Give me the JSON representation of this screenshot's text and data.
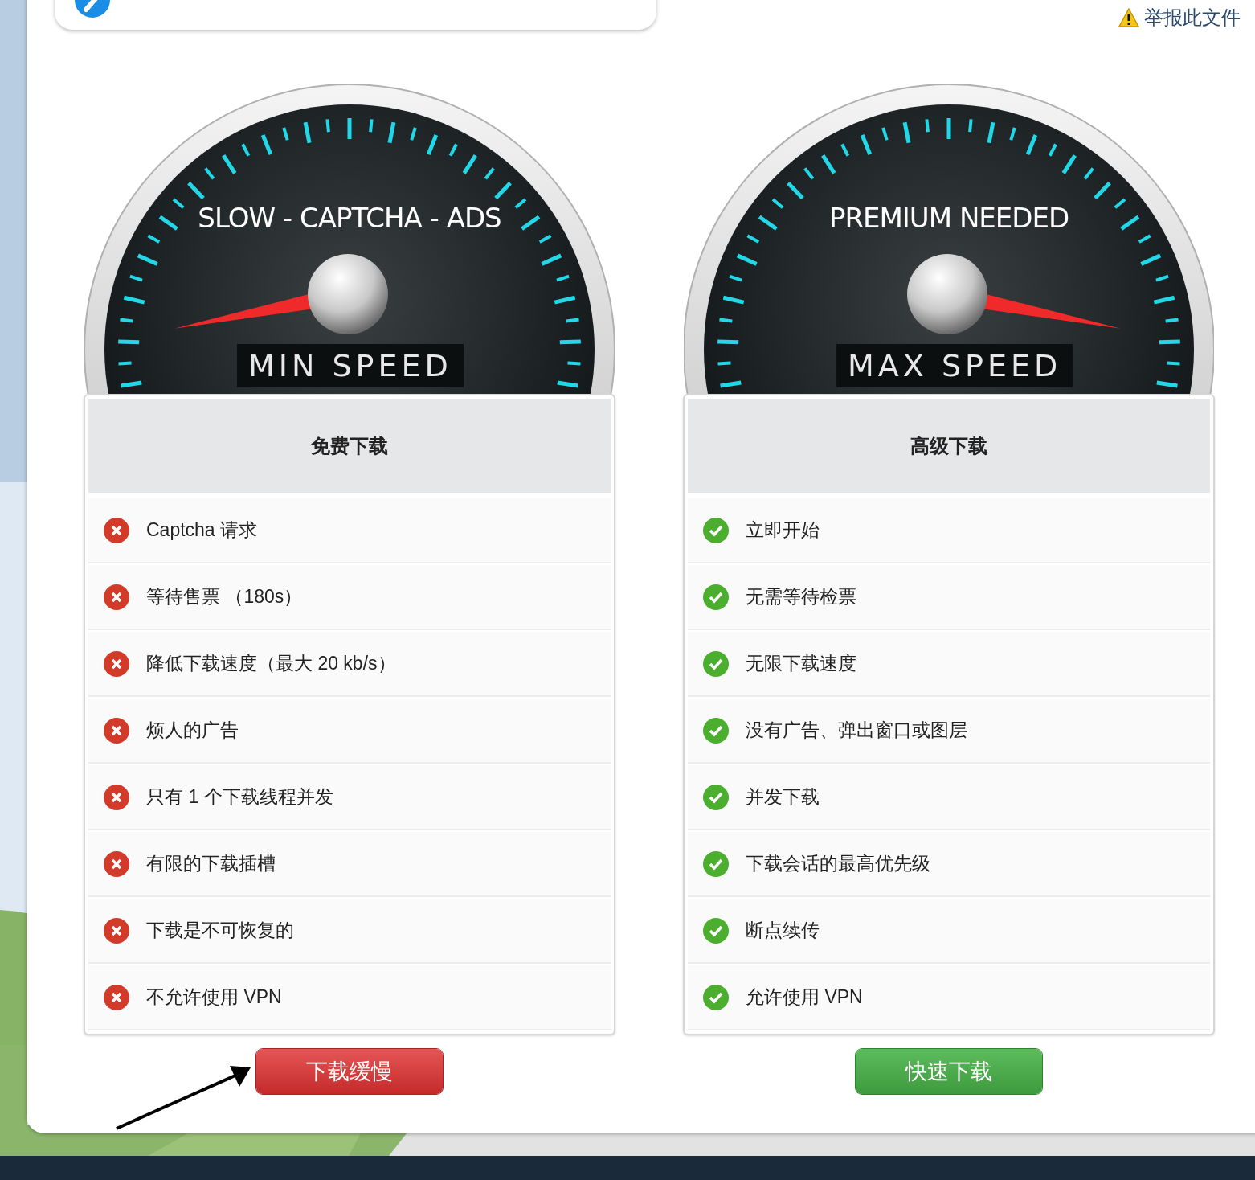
{
  "report_link": "举报此文件",
  "plans": [
    {
      "kind": "free",
      "gauge": {
        "caption": "SLOW - CAPTCHA - ADS",
        "label": "MIN SPEED"
      },
      "title": "免费下载",
      "features": [
        {
          "kind": "con",
          "text": "Captcha 请求"
        },
        {
          "kind": "con",
          "text": "等待售票 （180s）"
        },
        {
          "kind": "con",
          "text": "降低下载速度（最大 20 kb/s）"
        },
        {
          "kind": "con",
          "text": "烦人的广告"
        },
        {
          "kind": "con",
          "text": "只有 1 个下载线程并发"
        },
        {
          "kind": "con",
          "text": "有限的下载插槽"
        },
        {
          "kind": "con",
          "text": "下载是不可恢复的"
        },
        {
          "kind": "con",
          "text": "不允许使用 VPN"
        }
      ],
      "button": "下载缓慢"
    },
    {
      "kind": "premium",
      "gauge": {
        "caption": "PREMIUM NEEDED",
        "label": "MAX SPEED"
      },
      "title": "高级下载",
      "features": [
        {
          "kind": "pro",
          "text": "立即开始"
        },
        {
          "kind": "pro",
          "text": "无需等待检票"
        },
        {
          "kind": "pro",
          "text": "无限下载速度"
        },
        {
          "kind": "pro",
          "text": "没有广告、弹出窗口或图层"
        },
        {
          "kind": "pro",
          "text": "并发下载"
        },
        {
          "kind": "pro",
          "text": "下载会话的最高优先级"
        },
        {
          "kind": "pro",
          "text": "断点续传"
        },
        {
          "kind": "pro",
          "text": "允许使用 VPN"
        }
      ],
      "button": "快速下载"
    }
  ]
}
